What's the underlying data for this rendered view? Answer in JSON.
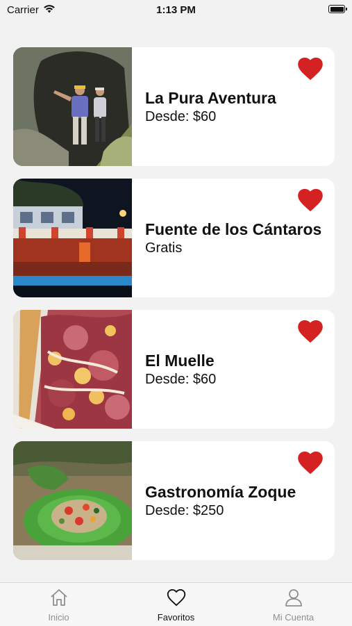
{
  "status_bar": {
    "carrier": "Carrier",
    "time": "1:13 PM"
  },
  "favorites": [
    {
      "title": "La Pura Aventura",
      "price": "Desde: $60",
      "image": "cave-rappel-photo"
    },
    {
      "title": "Fuente de los Cántaros",
      "price": "Gratis",
      "image": "fountain-night-photo"
    },
    {
      "title": "El Muelle",
      "price": "Desde: $60",
      "image": "food-sandwich-photo"
    },
    {
      "title": "Gastronomía Zoque",
      "price": "Desde: $250",
      "image": "food-leaf-plate-photo"
    }
  ],
  "tabbar": {
    "tabs": [
      {
        "label": "Inicio",
        "icon": "home-icon",
        "active": false
      },
      {
        "label": "Favoritos",
        "icon": "heart-outline-icon",
        "active": true
      },
      {
        "label": "Mi Cuenta",
        "icon": "person-icon",
        "active": false
      }
    ]
  },
  "colors": {
    "heart": "#d42121",
    "background": "#f2f2f2",
    "card": "#ffffff"
  }
}
